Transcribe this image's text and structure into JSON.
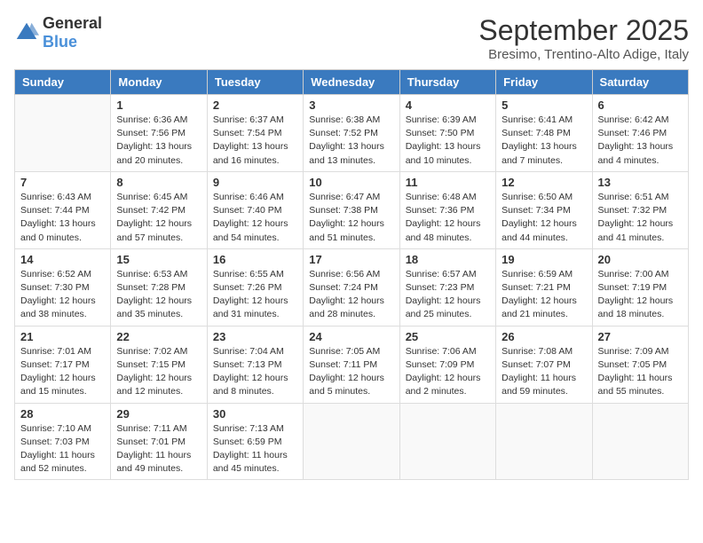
{
  "header": {
    "logo_general": "General",
    "logo_blue": "Blue",
    "month_title": "September 2025",
    "subtitle": "Bresimo, Trentino-Alto Adige, Italy"
  },
  "days_of_week": [
    "Sunday",
    "Monday",
    "Tuesday",
    "Wednesday",
    "Thursday",
    "Friday",
    "Saturday"
  ],
  "weeks": [
    [
      {
        "day": "",
        "sunrise": "",
        "sunset": "",
        "daylight": ""
      },
      {
        "day": "1",
        "sunrise": "Sunrise: 6:36 AM",
        "sunset": "Sunset: 7:56 PM",
        "daylight": "Daylight: 13 hours and 20 minutes."
      },
      {
        "day": "2",
        "sunrise": "Sunrise: 6:37 AM",
        "sunset": "Sunset: 7:54 PM",
        "daylight": "Daylight: 13 hours and 16 minutes."
      },
      {
        "day": "3",
        "sunrise": "Sunrise: 6:38 AM",
        "sunset": "Sunset: 7:52 PM",
        "daylight": "Daylight: 13 hours and 13 minutes."
      },
      {
        "day": "4",
        "sunrise": "Sunrise: 6:39 AM",
        "sunset": "Sunset: 7:50 PM",
        "daylight": "Daylight: 13 hours and 10 minutes."
      },
      {
        "day": "5",
        "sunrise": "Sunrise: 6:41 AM",
        "sunset": "Sunset: 7:48 PM",
        "daylight": "Daylight: 13 hours and 7 minutes."
      },
      {
        "day": "6",
        "sunrise": "Sunrise: 6:42 AM",
        "sunset": "Sunset: 7:46 PM",
        "daylight": "Daylight: 13 hours and 4 minutes."
      }
    ],
    [
      {
        "day": "7",
        "sunrise": "Sunrise: 6:43 AM",
        "sunset": "Sunset: 7:44 PM",
        "daylight": "Daylight: 13 hours and 0 minutes."
      },
      {
        "day": "8",
        "sunrise": "Sunrise: 6:45 AM",
        "sunset": "Sunset: 7:42 PM",
        "daylight": "Daylight: 12 hours and 57 minutes."
      },
      {
        "day": "9",
        "sunrise": "Sunrise: 6:46 AM",
        "sunset": "Sunset: 7:40 PM",
        "daylight": "Daylight: 12 hours and 54 minutes."
      },
      {
        "day": "10",
        "sunrise": "Sunrise: 6:47 AM",
        "sunset": "Sunset: 7:38 PM",
        "daylight": "Daylight: 12 hours and 51 minutes."
      },
      {
        "day": "11",
        "sunrise": "Sunrise: 6:48 AM",
        "sunset": "Sunset: 7:36 PM",
        "daylight": "Daylight: 12 hours and 48 minutes."
      },
      {
        "day": "12",
        "sunrise": "Sunrise: 6:50 AM",
        "sunset": "Sunset: 7:34 PM",
        "daylight": "Daylight: 12 hours and 44 minutes."
      },
      {
        "day": "13",
        "sunrise": "Sunrise: 6:51 AM",
        "sunset": "Sunset: 7:32 PM",
        "daylight": "Daylight: 12 hours and 41 minutes."
      }
    ],
    [
      {
        "day": "14",
        "sunrise": "Sunrise: 6:52 AM",
        "sunset": "Sunset: 7:30 PM",
        "daylight": "Daylight: 12 hours and 38 minutes."
      },
      {
        "day": "15",
        "sunrise": "Sunrise: 6:53 AM",
        "sunset": "Sunset: 7:28 PM",
        "daylight": "Daylight: 12 hours and 35 minutes."
      },
      {
        "day": "16",
        "sunrise": "Sunrise: 6:55 AM",
        "sunset": "Sunset: 7:26 PM",
        "daylight": "Daylight: 12 hours and 31 minutes."
      },
      {
        "day": "17",
        "sunrise": "Sunrise: 6:56 AM",
        "sunset": "Sunset: 7:24 PM",
        "daylight": "Daylight: 12 hours and 28 minutes."
      },
      {
        "day": "18",
        "sunrise": "Sunrise: 6:57 AM",
        "sunset": "Sunset: 7:23 PM",
        "daylight": "Daylight: 12 hours and 25 minutes."
      },
      {
        "day": "19",
        "sunrise": "Sunrise: 6:59 AM",
        "sunset": "Sunset: 7:21 PM",
        "daylight": "Daylight: 12 hours and 21 minutes."
      },
      {
        "day": "20",
        "sunrise": "Sunrise: 7:00 AM",
        "sunset": "Sunset: 7:19 PM",
        "daylight": "Daylight: 12 hours and 18 minutes."
      }
    ],
    [
      {
        "day": "21",
        "sunrise": "Sunrise: 7:01 AM",
        "sunset": "Sunset: 7:17 PM",
        "daylight": "Daylight: 12 hours and 15 minutes."
      },
      {
        "day": "22",
        "sunrise": "Sunrise: 7:02 AM",
        "sunset": "Sunset: 7:15 PM",
        "daylight": "Daylight: 12 hours and 12 minutes."
      },
      {
        "day": "23",
        "sunrise": "Sunrise: 7:04 AM",
        "sunset": "Sunset: 7:13 PM",
        "daylight": "Daylight: 12 hours and 8 minutes."
      },
      {
        "day": "24",
        "sunrise": "Sunrise: 7:05 AM",
        "sunset": "Sunset: 7:11 PM",
        "daylight": "Daylight: 12 hours and 5 minutes."
      },
      {
        "day": "25",
        "sunrise": "Sunrise: 7:06 AM",
        "sunset": "Sunset: 7:09 PM",
        "daylight": "Daylight: 12 hours and 2 minutes."
      },
      {
        "day": "26",
        "sunrise": "Sunrise: 7:08 AM",
        "sunset": "Sunset: 7:07 PM",
        "daylight": "Daylight: 11 hours and 59 minutes."
      },
      {
        "day": "27",
        "sunrise": "Sunrise: 7:09 AM",
        "sunset": "Sunset: 7:05 PM",
        "daylight": "Daylight: 11 hours and 55 minutes."
      }
    ],
    [
      {
        "day": "28",
        "sunrise": "Sunrise: 7:10 AM",
        "sunset": "Sunset: 7:03 PM",
        "daylight": "Daylight: 11 hours and 52 minutes."
      },
      {
        "day": "29",
        "sunrise": "Sunrise: 7:11 AM",
        "sunset": "Sunset: 7:01 PM",
        "daylight": "Daylight: 11 hours and 49 minutes."
      },
      {
        "day": "30",
        "sunrise": "Sunrise: 7:13 AM",
        "sunset": "Sunset: 6:59 PM",
        "daylight": "Daylight: 11 hours and 45 minutes."
      },
      {
        "day": "",
        "sunrise": "",
        "sunset": "",
        "daylight": ""
      },
      {
        "day": "",
        "sunrise": "",
        "sunset": "",
        "daylight": ""
      },
      {
        "day": "",
        "sunrise": "",
        "sunset": "",
        "daylight": ""
      },
      {
        "day": "",
        "sunrise": "",
        "sunset": "",
        "daylight": ""
      }
    ]
  ]
}
